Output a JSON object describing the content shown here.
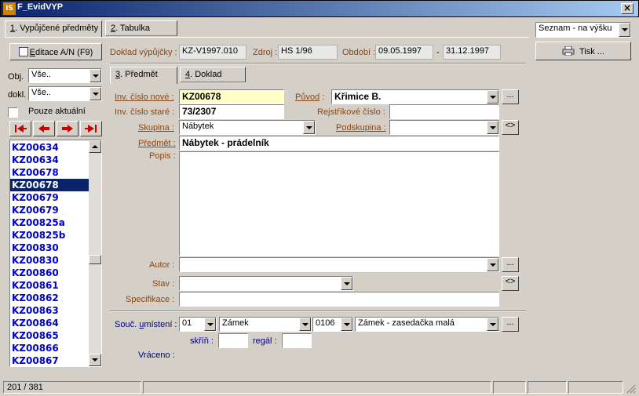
{
  "window": {
    "title": "F_EvidVYP",
    "icon_text": "IS",
    "close": "×"
  },
  "tabs_main": [
    {
      "key": "1",
      "rest": ". Vypůjčené předměty"
    },
    {
      "key": "2",
      "rest": ". Tabulka"
    }
  ],
  "edit_button": {
    "pre": "",
    "key": "E",
    "rest": "ditace A/N (F9)"
  },
  "filters": {
    "obj_label": "Obj.",
    "obj_value": "Vše..",
    "dokl_label": "dokl.",
    "dokl_value": "Vše..",
    "pouze_label": "Pouze aktuální"
  },
  "list_items": [
    "KZ00634",
    "KZ00634",
    "KZ00678",
    "KZ00678",
    "KZ00679",
    "KZ00679",
    "KZ00825a",
    "KZ00825b",
    "KZ00830",
    "KZ00830",
    "KZ00860",
    "KZ00861",
    "KZ00862",
    "KZ00863",
    "KZ00864",
    "KZ00865",
    "KZ00866",
    "KZ00867"
  ],
  "selected_index": 3,
  "header": {
    "doklad_label": "Doklad výpůjčky :",
    "doklad_value": "KZ-V1997.010",
    "zdroj_label": "Zdroj :",
    "zdroj_value": "HS 1/96",
    "obdobi_label": "Období :",
    "obdobi_from": "09.05.1997",
    "dash": "-",
    "obdobi_to": "31.12.1997"
  },
  "tabs_inner": [
    {
      "key": "3",
      "rest": ". Předmět"
    },
    {
      "key": "4",
      "rest": ". Doklad"
    }
  ],
  "form": {
    "inv_nove_label": "Inv. číslo nové :",
    "inv_nove_value": "KZ00678",
    "inv_stare_label": "Inv. číslo staré :",
    "inv_stare_value": "73/2307",
    "puvod_label_pre": "Původ",
    "puvod_label_post": " :",
    "puvod_value": "Křimice B.",
    "rejstrikove_label": "Rejstříkové číslo :",
    "rejstrikove_value": "",
    "skupina_label": "Skupina :",
    "skupina_value": "Nábytek",
    "podskupina_label": "Podskupina :",
    "podskupina_value": "",
    "predmet_label": "Předmět :",
    "predmet_value": "Nábytek - prádelník",
    "popis_label": "Popis :",
    "popis_value": "",
    "autor_label": "Autor :",
    "autor_value": "",
    "stav_label": "Stav :",
    "stav_value": "",
    "specifikace_label": "Specifikace :",
    "specifikace_value": "",
    "umisteni_label_pre": "Souč. ",
    "umisteni_label_key": "u",
    "umisteni_label_post": "místení :",
    "umisteni_code1": "01",
    "umisteni_name1": "Zámek",
    "umisteni_code2": "0106",
    "umisteni_name2": "Zámek - zasedačka malá",
    "skrin_label": "skříň :",
    "skrin_value": "",
    "regal_label": "regál :",
    "regal_value": "",
    "vraceno_label": "Vráceno :",
    "ellipsis": "...",
    "swap": "<>"
  },
  "right_panel": {
    "view_select": "Seznam - na výšku",
    "print_label": "Tisk ..."
  },
  "status": {
    "record": "201 / 381"
  }
}
